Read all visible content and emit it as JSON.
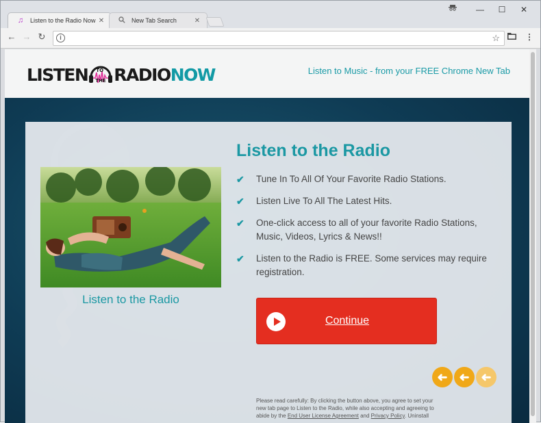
{
  "browser": {
    "tabs": [
      {
        "title": "Listen to the Radio Now",
        "icon": "music-note-icon",
        "active": true
      },
      {
        "title": "New Tab Search",
        "icon": "search-icon",
        "active": false
      }
    ],
    "address": ""
  },
  "site": {
    "logo": {
      "part1": "LISTEN",
      "mark_top": "TO",
      "mark_bottom": "THE",
      "part2": "RADIO",
      "part3": "NOW"
    },
    "tagline": "Listen to Music - from your FREE Chrome New Tab",
    "heading": "Listen to the Radio",
    "features": [
      "Tune In To All Of Your Favorite Radio Stations.",
      "Listen Live To All The Latest Hits.",
      "One-click access to all of your favorite Radio Stations, Music, Videos, Lyrics & News!!",
      "Listen to the Radio is FREE. Some services may require registration."
    ],
    "photo_caption": "Listen to the Radio",
    "continue_label": "Continue",
    "disclaimer": {
      "text1": "Please read carefully: By clicking the button above, you agree to set your new tab page to Listen to the Radio, while also accepting and agreeing to abide by the ",
      "eula": "End User License Agreement",
      "and": " and ",
      "privacy": "Privacy Policy",
      "text2": ". Uninstall"
    }
  },
  "colors": {
    "accent": "#1b98a3",
    "button": "#e42e20",
    "arrows": "#f0a818",
    "background": "#0f3c55"
  }
}
